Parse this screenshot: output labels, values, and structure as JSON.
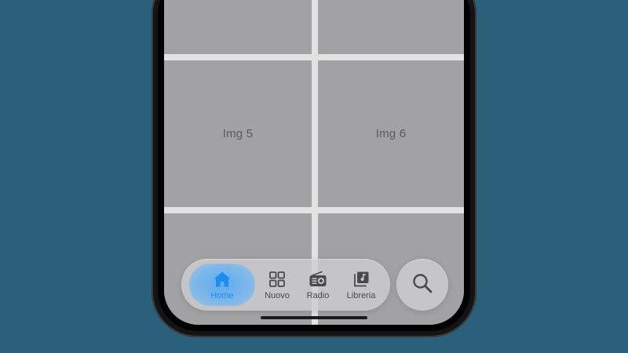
{
  "grid": {
    "tiles": [
      {
        "label": ""
      },
      {
        "label": ""
      },
      {
        "label": "Img 5"
      },
      {
        "label": "Img 6"
      },
      {
        "label": ""
      },
      {
        "label": ""
      }
    ]
  },
  "tabbar": {
    "active_tab": "Home",
    "tabs": [
      {
        "label": "Home",
        "icon": "house-icon",
        "active": true
      },
      {
        "label": "Nuovo",
        "icon": "grid-icon",
        "active": false
      },
      {
        "label": "Radio",
        "icon": "radio-icon",
        "active": false
      },
      {
        "label": "Libreria",
        "icon": "music-library-icon",
        "active": false
      }
    ]
  },
  "search": {
    "icon": "search-icon"
  },
  "colors": {
    "background": "#2a6079",
    "accent": "#1f8cf0",
    "tile": "#a2a2a4",
    "tile_text": "#5c5c5e"
  }
}
